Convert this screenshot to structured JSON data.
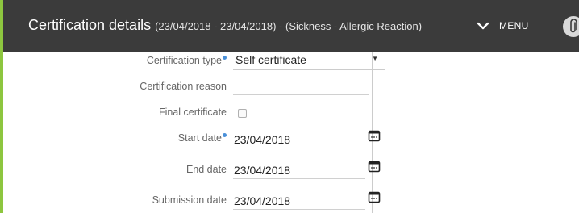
{
  "header": {
    "title": "Certification details",
    "subtitle": "(23/04/2018 - 23/04/2018) - (Sickness - Allergic Reaction)",
    "menu_label": "MENU",
    "menu_icon": "chevron-down-icon",
    "attach_icon": "paperclip-icon",
    "background": "#3b3b3b"
  },
  "form": {
    "certification_type": {
      "label": "Certification type",
      "value": "Self certificate",
      "required": true
    },
    "certification_reason": {
      "label": "Certification reason",
      "value": ""
    },
    "final_certificate": {
      "label": "Final certificate",
      "checked": false
    },
    "start_date": {
      "label": "Start date",
      "value": "23/04/2018",
      "required": true
    },
    "end_date": {
      "label": "End date",
      "value": "23/04/2018"
    },
    "submission_date": {
      "label": "Submission date",
      "value": "23/04/2018"
    }
  },
  "colors": {
    "accent_border": "#8dc63f",
    "required_dot": "#4a90d9"
  }
}
